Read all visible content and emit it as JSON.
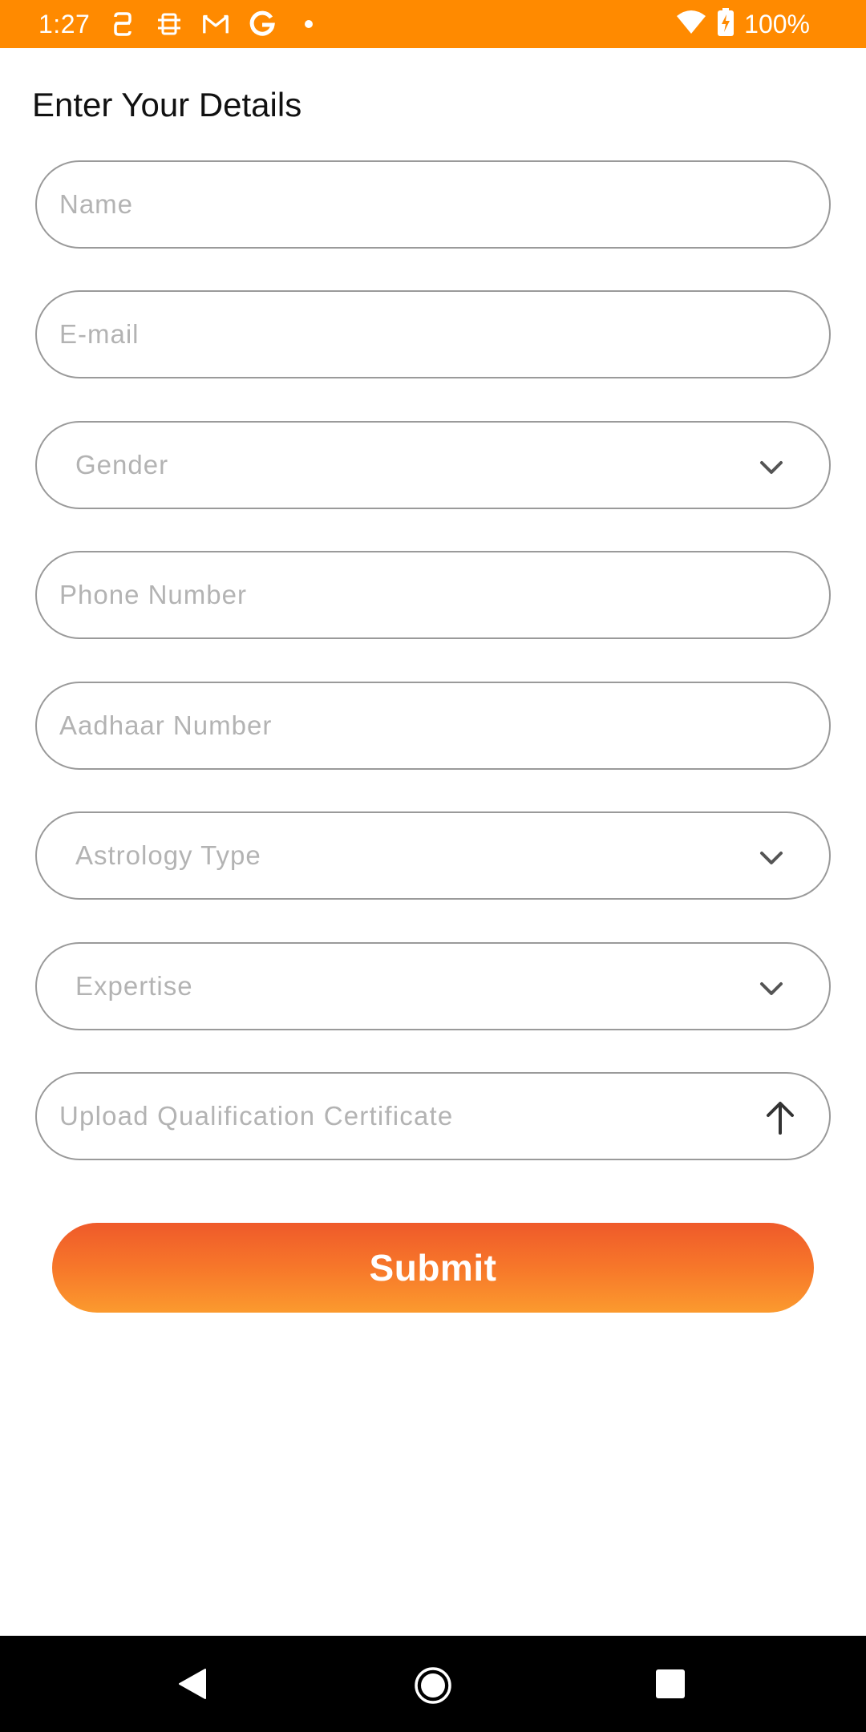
{
  "status_bar": {
    "time": "1:27",
    "battery": "100%",
    "background": "#ff8a00",
    "left_icons": [
      "notification-icon",
      "screenshot-icon",
      "gmail-icon",
      "google-icon",
      "dot-icon"
    ],
    "right_icons": [
      "wifi-icon",
      "battery-charging-icon"
    ]
  },
  "page": {
    "title": "Enter Your Details"
  },
  "form": {
    "name_placeholder": "Name",
    "email_placeholder": "E-mail",
    "gender_label": "Gender",
    "phone_placeholder": "Phone Number",
    "aadhaar_placeholder": "Aadhaar Number",
    "astrology_type_label": "Astrology Type",
    "expertise_label": "Expertise",
    "upload_label": "Upload Qualification Certificate",
    "submit_label": "Submit"
  },
  "colors": {
    "accent": "#ff8a00",
    "button_top": "#ef5a2a",
    "button_bottom": "#fb9a2e",
    "placeholder": "#b3b3b3",
    "border": "#9a9a9a"
  },
  "nav_bar": {
    "icons": [
      "back-icon",
      "home-icon",
      "recents-icon"
    ]
  }
}
